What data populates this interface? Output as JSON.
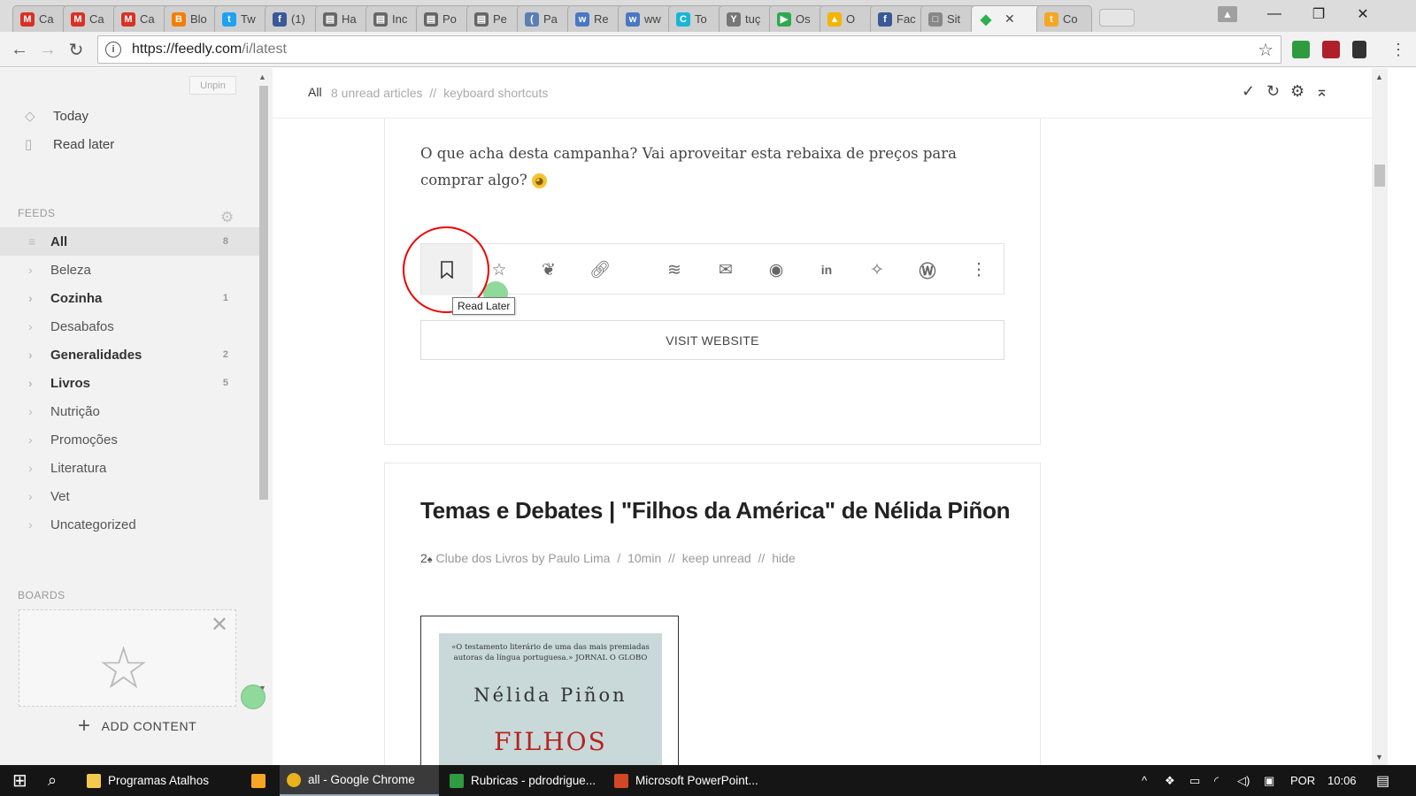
{
  "browser": {
    "tabs": [
      {
        "label": "Ca",
        "fav": "M",
        "color": "#d93025"
      },
      {
        "label": "Ca",
        "fav": "M",
        "color": "#d93025"
      },
      {
        "label": "Ca",
        "fav": "M",
        "color": "#d93025"
      },
      {
        "label": "Blo",
        "fav": "B",
        "color": "#f57d00"
      },
      {
        "label": "Tw",
        "fav": "t",
        "color": "#1da1f2"
      },
      {
        "label": "(1)",
        "fav": "f",
        "color": "#3b5998"
      },
      {
        "label": "Ha",
        "fav": "▤",
        "color": "#666666"
      },
      {
        "label": "Inc",
        "fav": "▤",
        "color": "#666666"
      },
      {
        "label": "Po",
        "fav": "▤",
        "color": "#666666"
      },
      {
        "label": "Pe",
        "fav": "▤",
        "color": "#666666"
      },
      {
        "label": "Pa",
        "fav": "(",
        "color": "#5b7fb5"
      },
      {
        "label": "Re",
        "fav": "w",
        "color": "#4a77c4"
      },
      {
        "label": "ww",
        "fav": "w",
        "color": "#4a77c4"
      },
      {
        "label": "To",
        "fav": "C",
        "color": "#19b5d6"
      },
      {
        "label": "tuç",
        "fav": "Y",
        "color": "#777777"
      },
      {
        "label": "Os",
        "fav": "▶",
        "color": "#2fa84f"
      },
      {
        "label": "O",
        "fav": "▲",
        "color": "#f4b400"
      },
      {
        "label": "Fac",
        "fav": "f",
        "color": "#3b5998"
      },
      {
        "label": "Sit",
        "fav": "□",
        "color": "#888888"
      }
    ],
    "active_tab": {
      "fav": "◆",
      "color": "#2bb24c",
      "close": "✕"
    },
    "last_tab": {
      "label": "Co",
      "fav": "t",
      "color": "#f5a623"
    },
    "url_host": "https://feedly.com",
    "url_path": "/i/latest",
    "controls": {
      "minimize": "—",
      "restore": "❐",
      "close": "✕"
    }
  },
  "sidebar": {
    "unpin": "Unpin",
    "today": "Today",
    "read_later": "Read later",
    "feeds_label": "FEEDS",
    "feeds": [
      {
        "label": "All",
        "count": "8",
        "bold": true,
        "selected": true
      },
      {
        "label": "Beleza",
        "count": "",
        "bold": false
      },
      {
        "label": "Cozinha",
        "count": "1",
        "bold": true
      },
      {
        "label": "Desabafos",
        "count": "",
        "bold": false
      },
      {
        "label": "Generalidades",
        "count": "2",
        "bold": true
      },
      {
        "label": "Livros",
        "count": "5",
        "bold": true
      },
      {
        "label": "Nutrição",
        "count": "",
        "bold": false
      },
      {
        "label": "Promoções",
        "count": "",
        "bold": false
      },
      {
        "label": "Literatura",
        "count": "",
        "bold": false
      },
      {
        "label": "Vet",
        "count": "",
        "bold": false
      },
      {
        "label": "Uncategorized",
        "count": "",
        "bold": false
      }
    ],
    "boards_label": "BOARDS",
    "add_content": "ADD CONTENT"
  },
  "header": {
    "all": "All",
    "unread": "8 unread articles",
    "sep": "//",
    "shortcuts": "keyboard shortcuts"
  },
  "card1": {
    "text": "O que acha desta campanha? Vai aproveitar esta rebaixa de preços para comprar algo?",
    "tooltip": "Read Later",
    "visit": "VISIT WEBSITE"
  },
  "card2": {
    "title": "Temas e Debates | \"Filhos da América\" de Nélida Piñon",
    "count": "2",
    "source": "Clube dos Livros by Paulo Lima",
    "time": "10min",
    "keep_unread": "keep unread",
    "hide": "hide",
    "book_quote": "«O testamento literário de uma das mais premiadas autoras da língua portuguesa.» JORNAL O GLOBO",
    "book_author": "Nélida Piñon",
    "book_title": "FILHOS"
  },
  "taskbar": {
    "items": [
      "Programas Atalhos",
      "all - Google Chrome",
      "Rubricas - pdrodrigue...",
      "Microsoft PowerPoint..."
    ],
    "lang": "POR",
    "time": "10:06"
  }
}
